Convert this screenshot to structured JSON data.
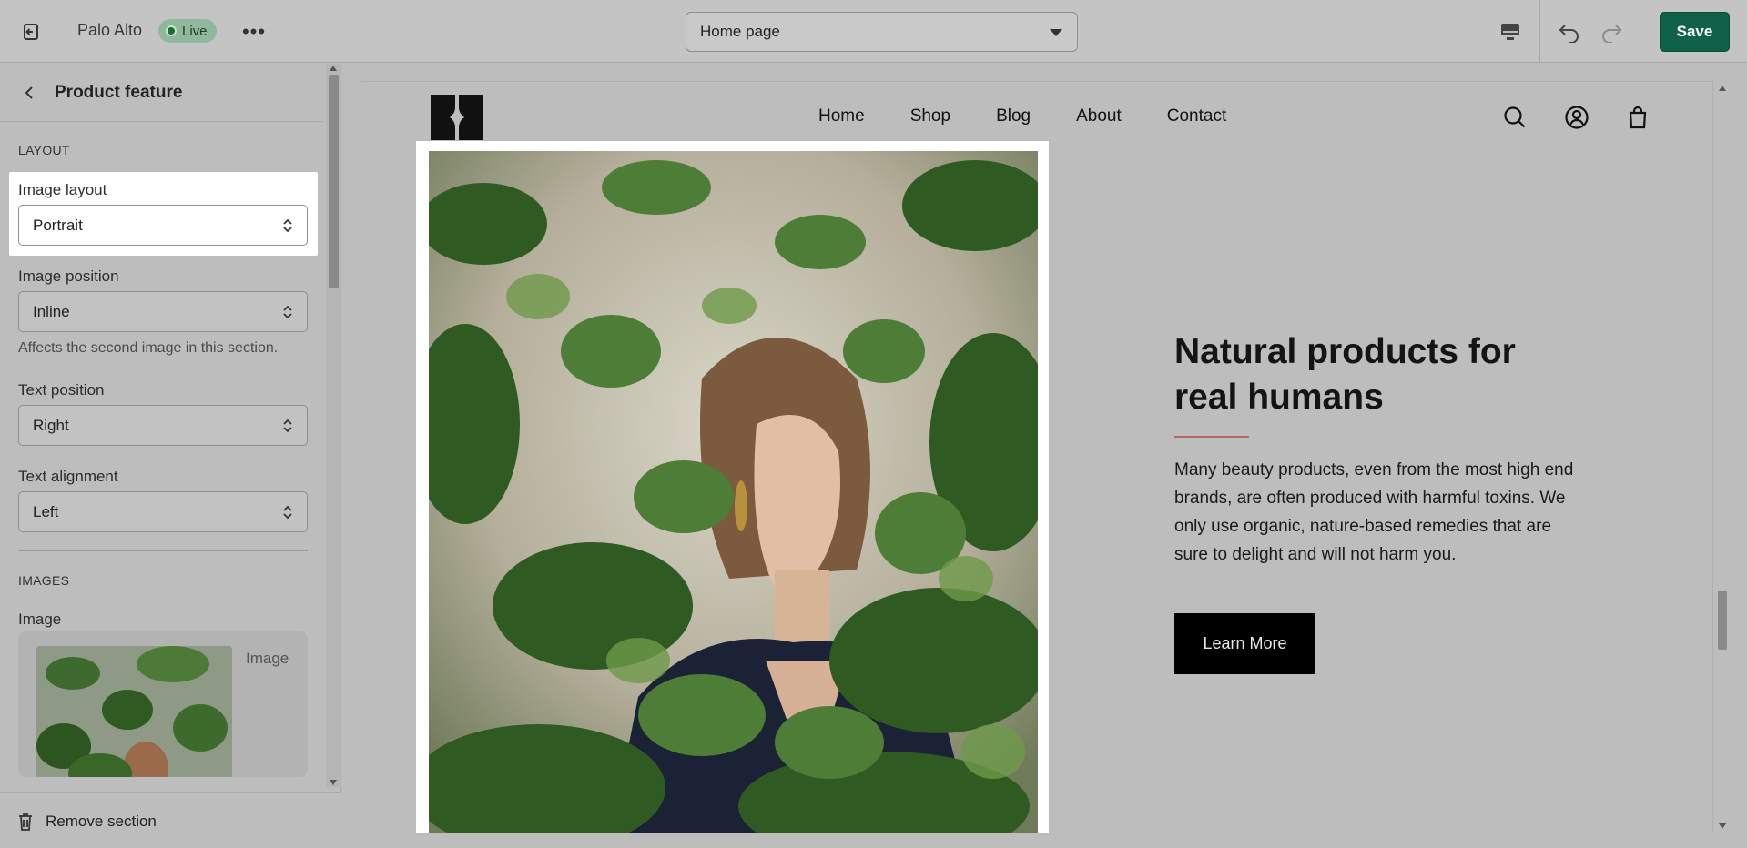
{
  "topbar": {
    "store_name": "Palo Alto",
    "live_label": "Live",
    "page_selector_value": "Home page",
    "save_label": "Save"
  },
  "sidebar": {
    "title": "Product feature",
    "layout_heading": "LAYOUT",
    "image_layout": {
      "label": "Image layout",
      "value": "Portrait"
    },
    "image_position": {
      "label": "Image position",
      "value": "Inline",
      "help": "Affects the second image in this section."
    },
    "text_position": {
      "label": "Text position",
      "value": "Right"
    },
    "text_alignment": {
      "label": "Text alignment",
      "value": "Left"
    },
    "images_heading": "IMAGES",
    "image_field_label": "Image",
    "image_card_caption": "Image",
    "remove_section_label": "Remove section"
  },
  "preview": {
    "nav": [
      "Home",
      "Shop",
      "Blog",
      "About",
      "Contact"
    ],
    "headline": "Natural products for real humans",
    "body": "Many beauty products, even from the most high end brands, are often produced with harmful toxins. We only use organic, nature-based remedies that are sure to delight and will not harm you.",
    "cta_label": "Learn More"
  },
  "colors": {
    "save_button": "#0f6149",
    "accent_line": "#b5685f",
    "live_badge": "#8fb89c"
  }
}
